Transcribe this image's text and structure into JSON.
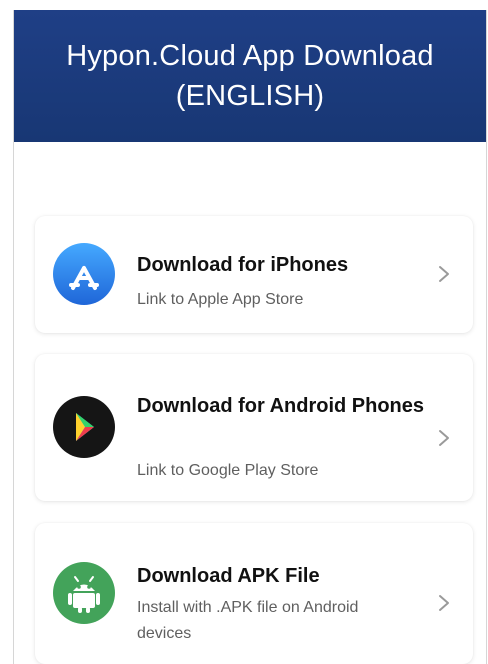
{
  "header": {
    "title_line1": "Hypon.Cloud App Download",
    "title_line2": "(ENGLISH)"
  },
  "downloads": [
    {
      "title": "Download for iPhones",
      "subtitle": "Link to Apple App Store",
      "icon": "app-store-icon",
      "icon_color": "#2f7de6"
    },
    {
      "title": "Download for Android Phones",
      "subtitle": "Link to Google Play Store",
      "icon": "google-play-icon",
      "icon_color": "#111111"
    },
    {
      "title": "Download APK File",
      "subtitle": "Install with .APK file on Android devices",
      "icon": "android-apk-icon",
      "icon_color": "#3fa65a"
    }
  ],
  "colors": {
    "header_background": "#1f3f86",
    "title_text": "#111111",
    "subtitle_text": "#5f5f5f",
    "chevron": "#9a9a9a"
  }
}
